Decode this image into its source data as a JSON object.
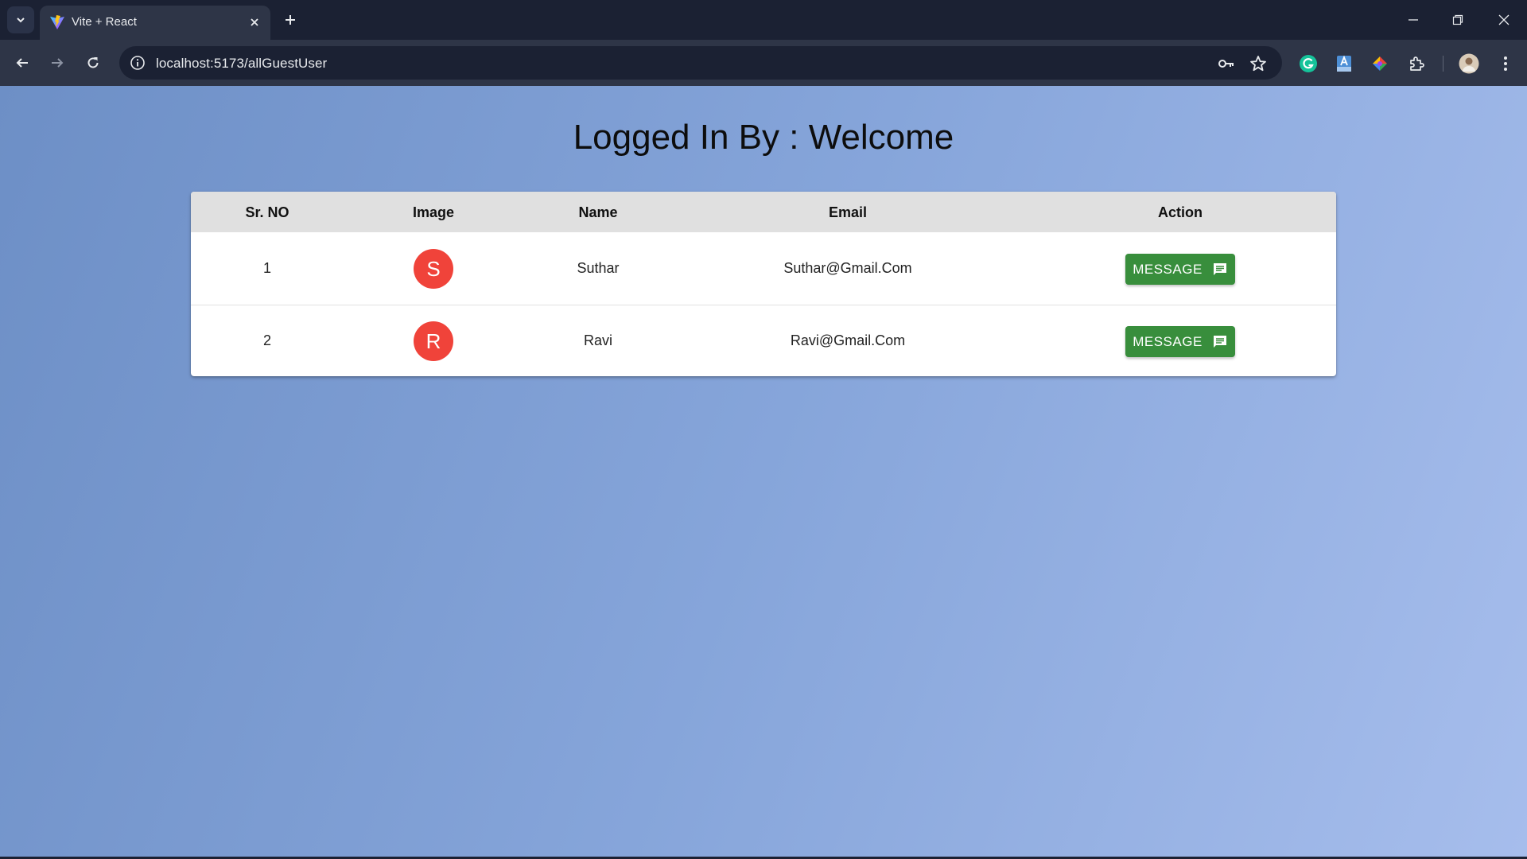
{
  "browser": {
    "tab_title": "Vite + React",
    "url": "localhost:5173/allGuestUser"
  },
  "page": {
    "title": "Logged In By : Welcome"
  },
  "table": {
    "headers": {
      "sr_no": "Sr. NO",
      "image": "Image",
      "name": "Name",
      "email": "Email",
      "action": "Action"
    },
    "rows": [
      {
        "sr_no": "1",
        "avatar_letter": "S",
        "name": "Suthar",
        "email": "Suthar@Gmail.Com",
        "action_label": "MESSAGE"
      },
      {
        "sr_no": "2",
        "avatar_letter": "R",
        "name": "Ravi",
        "email": "Ravi@Gmail.Com",
        "action_label": "MESSAGE"
      }
    ]
  },
  "colors": {
    "avatar": "#f0433a",
    "message_button": "#388e3c",
    "header_background": "#e0e0e0"
  },
  "icons": {
    "tab_search": "chevron-down-icon",
    "favicon": "vite-logo-icon",
    "back": "arrow-left-icon",
    "forward": "arrow-right-icon",
    "reload": "reload-icon",
    "site_info": "info-icon",
    "password": "key-icon",
    "bookmark": "star-icon",
    "message": "chat-icon"
  }
}
